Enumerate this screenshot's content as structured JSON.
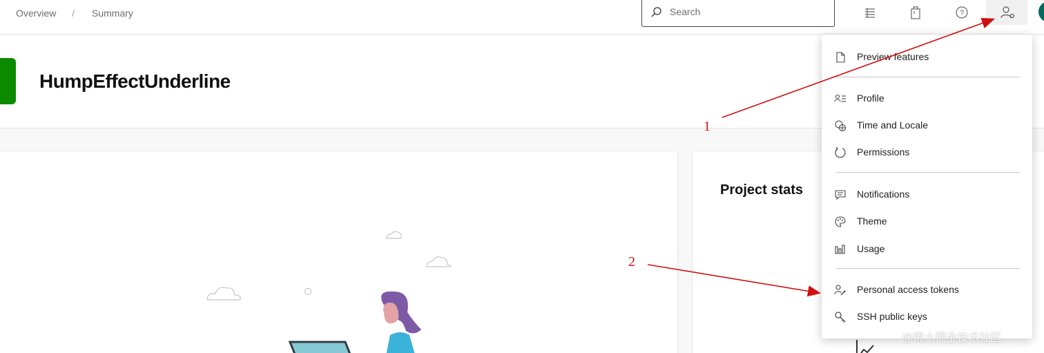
{
  "breadcrumb": {
    "items": [
      "Overview",
      "Summary"
    ],
    "separator": "/"
  },
  "search": {
    "placeholder": "Search"
  },
  "topbar_icons": [
    "task-list-icon",
    "shopping-bag-icon",
    "help-icon",
    "user-settings-icon"
  ],
  "project": {
    "name": "HumpEffectUnderline",
    "logo_color": "#0b8a00"
  },
  "stats": {
    "title": "Project stats"
  },
  "user_menu": {
    "items": [
      {
        "label": "Preview features",
        "icon": "document-icon"
      },
      {
        "label": "Profile",
        "icon": "profile-icon"
      },
      {
        "label": "Time and Locale",
        "icon": "globe-clock-icon"
      },
      {
        "label": "Permissions",
        "icon": "permissions-icon"
      },
      {
        "label": "Notifications",
        "icon": "chat-icon"
      },
      {
        "label": "Theme",
        "icon": "palette-icon"
      },
      {
        "label": "Usage",
        "icon": "bar-chart-icon"
      },
      {
        "label": "Personal access tokens",
        "icon": "key-person-icon"
      },
      {
        "label": "SSH public keys",
        "icon": "ssh-key-icon"
      }
    ]
  },
  "annotations": {
    "one": "1",
    "two": "2",
    "color": "#d01010"
  },
  "watermark": "@稀土掘金技术社区"
}
